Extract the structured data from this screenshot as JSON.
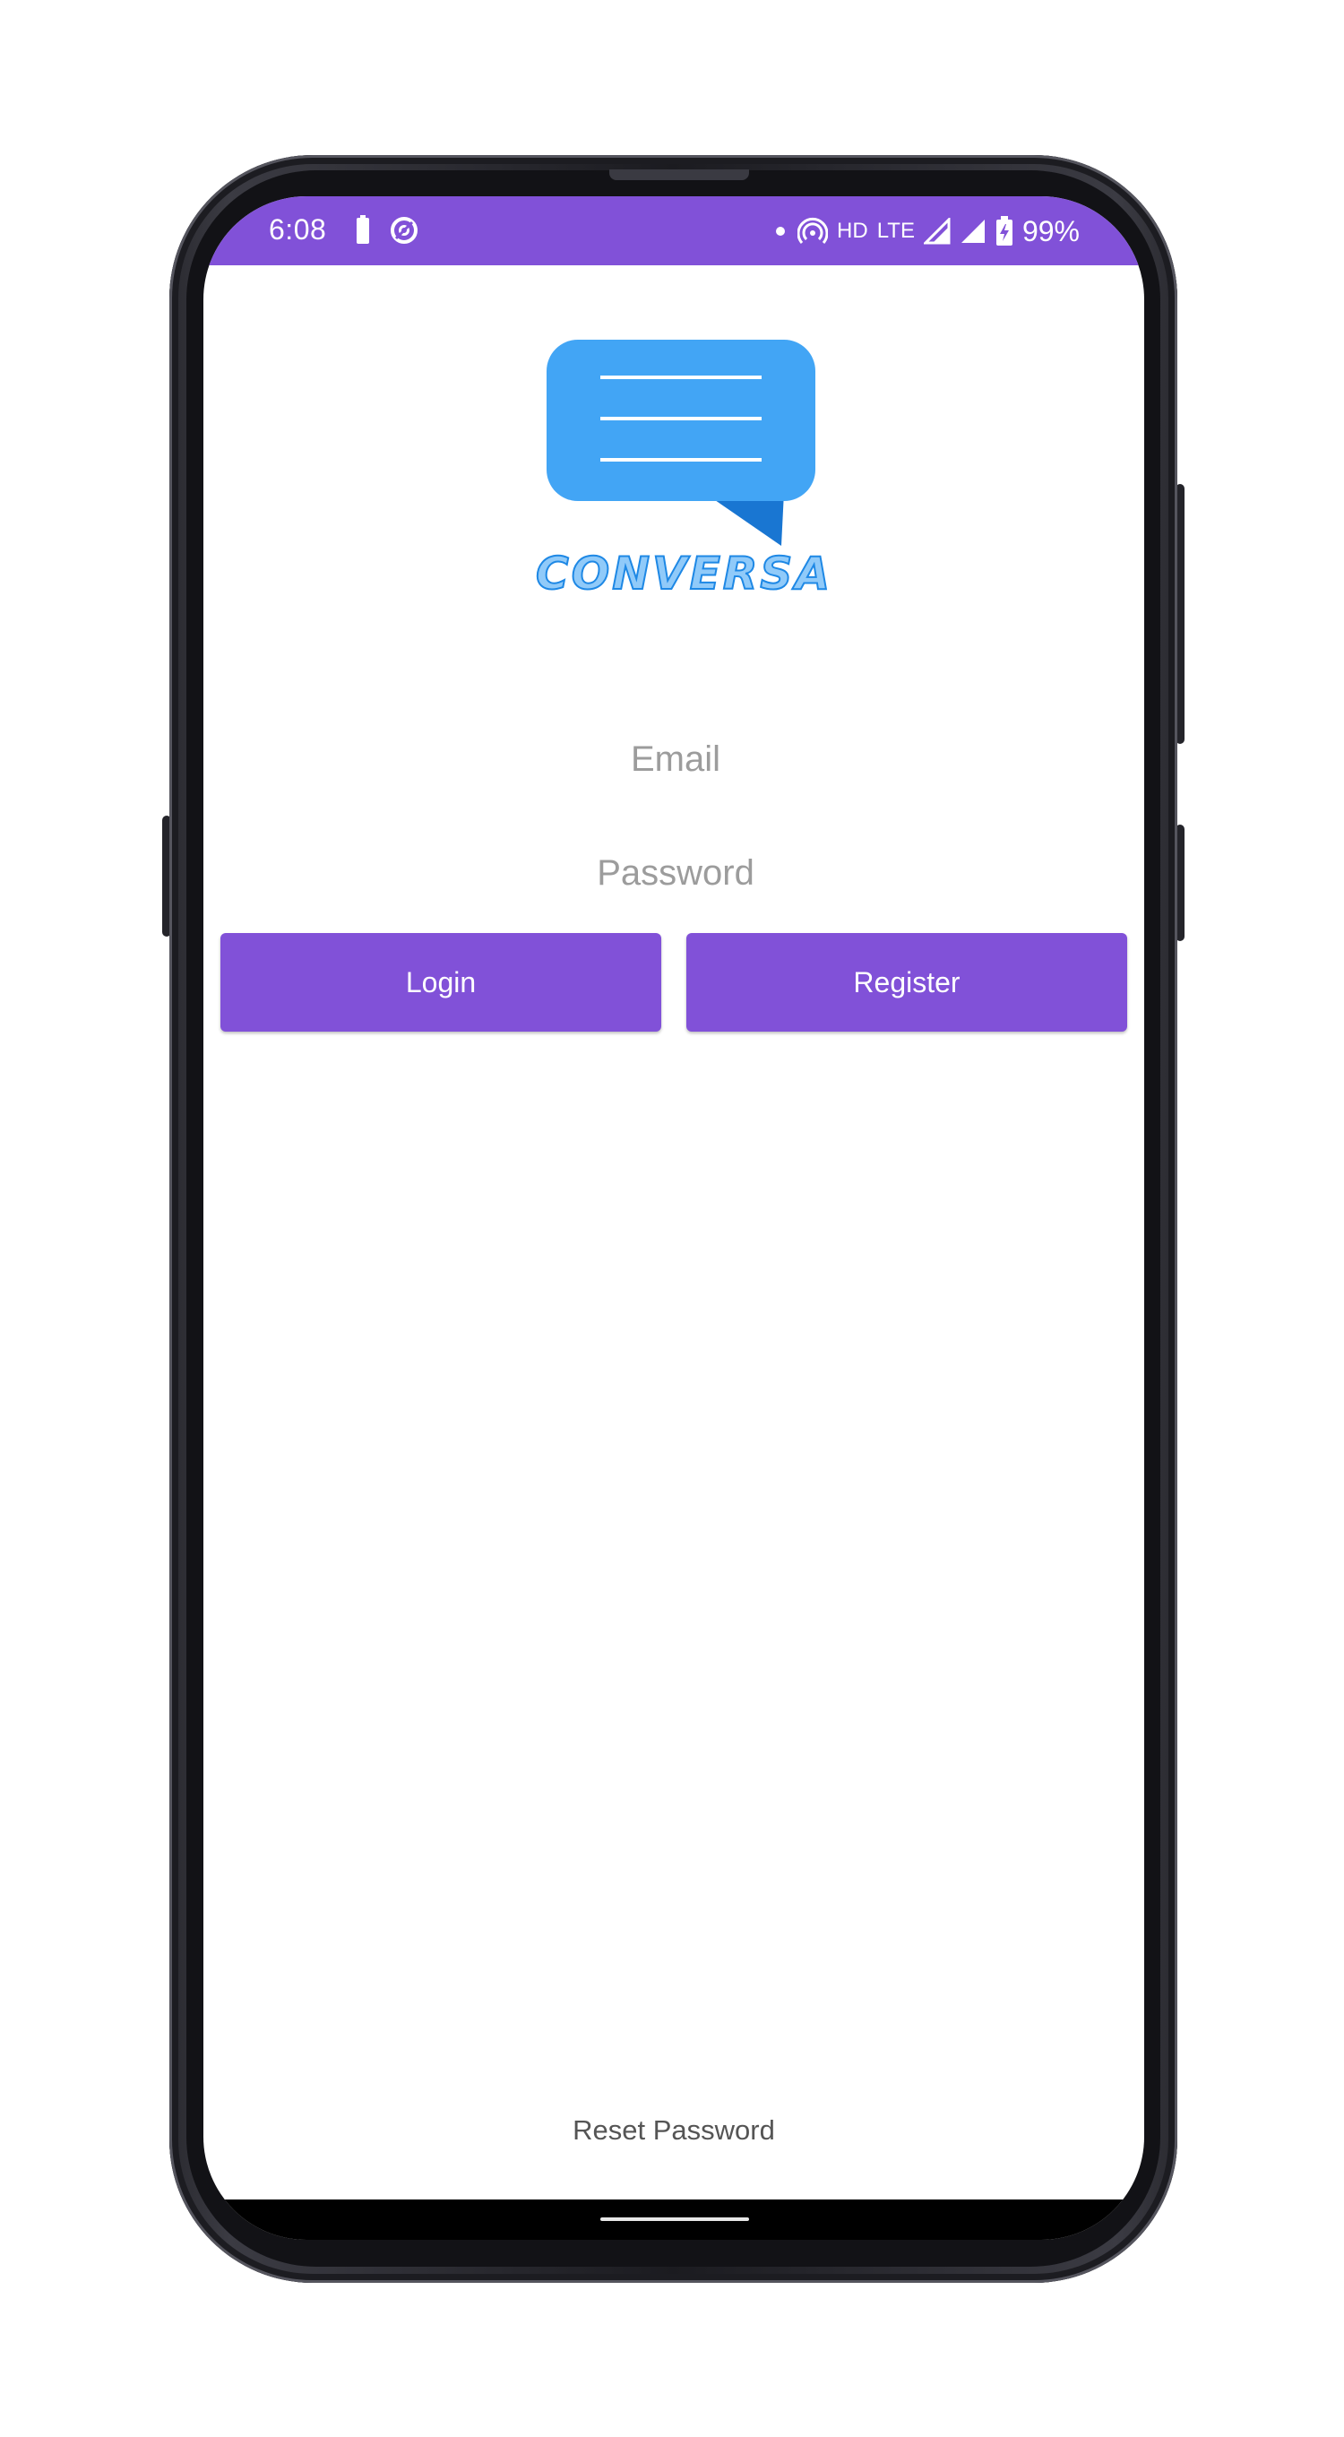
{
  "status_bar": {
    "time": "6:08",
    "left_icons": [
      "battery-saver-icon",
      "data-saver-icon"
    ],
    "right_icons": [
      "notification-dot-icon",
      "hotspot-icon",
      "signal-icon",
      "signal-icon",
      "battery-charging-icon"
    ],
    "hd_label": "HD",
    "network_label": "LTE",
    "battery": "99%",
    "color": "#8151d8"
  },
  "logo": {
    "text": "CONVERSA",
    "icon": "chat-bubble-icon",
    "bubble_color": "#42a5f5",
    "tail_color": "#1976d2"
  },
  "login_form": {
    "email_placeholder": "Email",
    "email_value": "",
    "password_placeholder": "Password",
    "password_value": ""
  },
  "buttons": {
    "login_label": "Login",
    "register_label": "Register",
    "color": "#8151d8"
  },
  "footer": {
    "reset_password_label": "Reset Password"
  }
}
